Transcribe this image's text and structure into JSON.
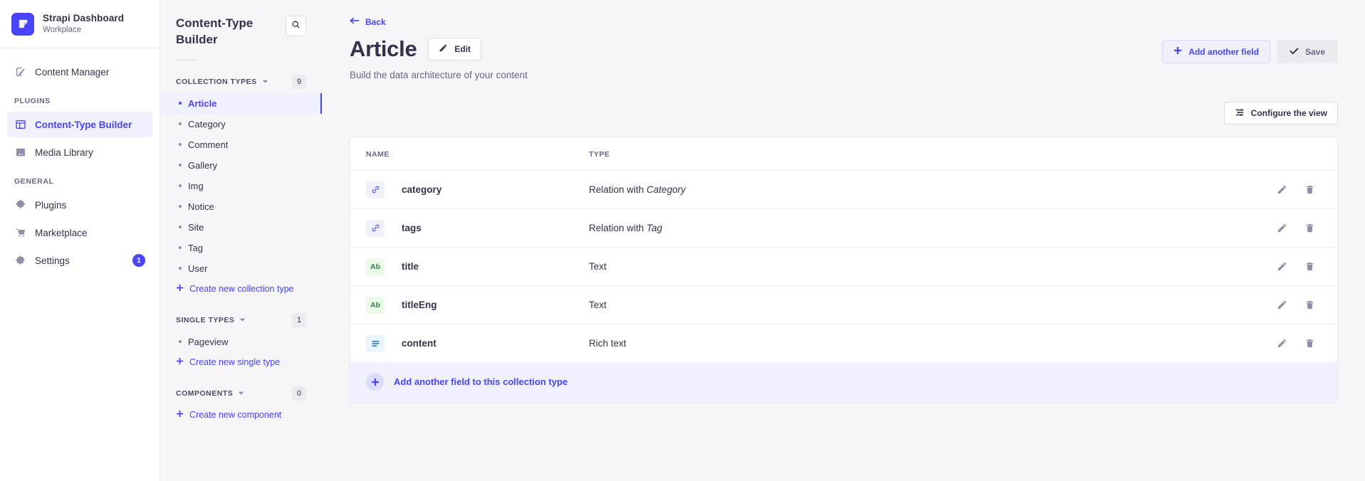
{
  "brand": {
    "title": "Strapi Dashboard",
    "subtitle": "Workplace",
    "logo_color": "#4945ff"
  },
  "sidebar": {
    "top_items": [
      {
        "label": "Content Manager",
        "icon": "pencil-square-icon",
        "active": false
      }
    ],
    "sections": [
      {
        "label": "PLUGINS",
        "items": [
          {
            "label": "Content-Type Builder",
            "icon": "layout-icon",
            "active": true
          },
          {
            "label": "Media Library",
            "icon": "image-icon",
            "active": false
          }
        ]
      },
      {
        "label": "GENERAL",
        "items": [
          {
            "label": "Plugins",
            "icon": "puzzle-icon",
            "active": false,
            "badge": ""
          },
          {
            "label": "Marketplace",
            "icon": "cart-icon",
            "active": false,
            "badge": ""
          },
          {
            "label": "Settings",
            "icon": "gear-icon",
            "active": false,
            "badge": "1"
          }
        ]
      }
    ]
  },
  "ctb_panel": {
    "title": "Content-Type Builder",
    "search_icon": "search-icon",
    "groups": [
      {
        "label": "COLLECTION TYPES",
        "count": "9",
        "items": [
          {
            "label": "Article",
            "active": true
          },
          {
            "label": "Category",
            "active": false
          },
          {
            "label": "Comment",
            "active": false
          },
          {
            "label": "Gallery",
            "active": false
          },
          {
            "label": "Img",
            "active": false
          },
          {
            "label": "Notice",
            "active": false
          },
          {
            "label": "Site",
            "active": false
          },
          {
            "label": "Tag",
            "active": false
          },
          {
            "label": "User",
            "active": false
          }
        ],
        "create_label": "Create new collection type"
      },
      {
        "label": "SINGLE TYPES",
        "count": "1",
        "items": [
          {
            "label": "Pageview",
            "active": false
          }
        ],
        "create_label": "Create new single type"
      },
      {
        "label": "COMPONENTS",
        "count": "0",
        "items": [],
        "create_label": "Create new component"
      }
    ]
  },
  "main": {
    "back_label": "Back",
    "page_title": "Article",
    "edit_label": "Edit",
    "subtitle": "Build the data architecture of your content",
    "add_field_label": "Add another field",
    "save_label": "Save",
    "configure_label": "Configure the view",
    "columns": {
      "name": "NAME",
      "type": "TYPE"
    },
    "rows": [
      {
        "name": "category",
        "badge": "relation",
        "badge_text": "",
        "type_prefix": "Relation with ",
        "type_target": "Category"
      },
      {
        "name": "tags",
        "badge": "relation",
        "badge_text": "",
        "type_prefix": "Relation with ",
        "type_target": "Tag"
      },
      {
        "name": "title",
        "badge": "text",
        "badge_text": "Ab",
        "type_prefix": "Text",
        "type_target": ""
      },
      {
        "name": "titleEng",
        "badge": "text",
        "badge_text": "Ab",
        "type_prefix": "Text",
        "type_target": ""
      },
      {
        "name": "content",
        "badge": "richtext",
        "badge_text": "",
        "type_prefix": "Rich text",
        "type_target": ""
      }
    ],
    "row_actions": {
      "edit": "pencil-icon",
      "delete": "trash-icon"
    },
    "footer_label": "Add another field to this collection type"
  },
  "colors": {
    "accent": "#4945ff",
    "accent_bg": "#f0f0ff",
    "text": "#32324d",
    "muted": "#666687",
    "green": "#328048",
    "green_bg": "#eafbe7",
    "blue": "#0c75af",
    "blue_bg": "#eaf5ff"
  }
}
